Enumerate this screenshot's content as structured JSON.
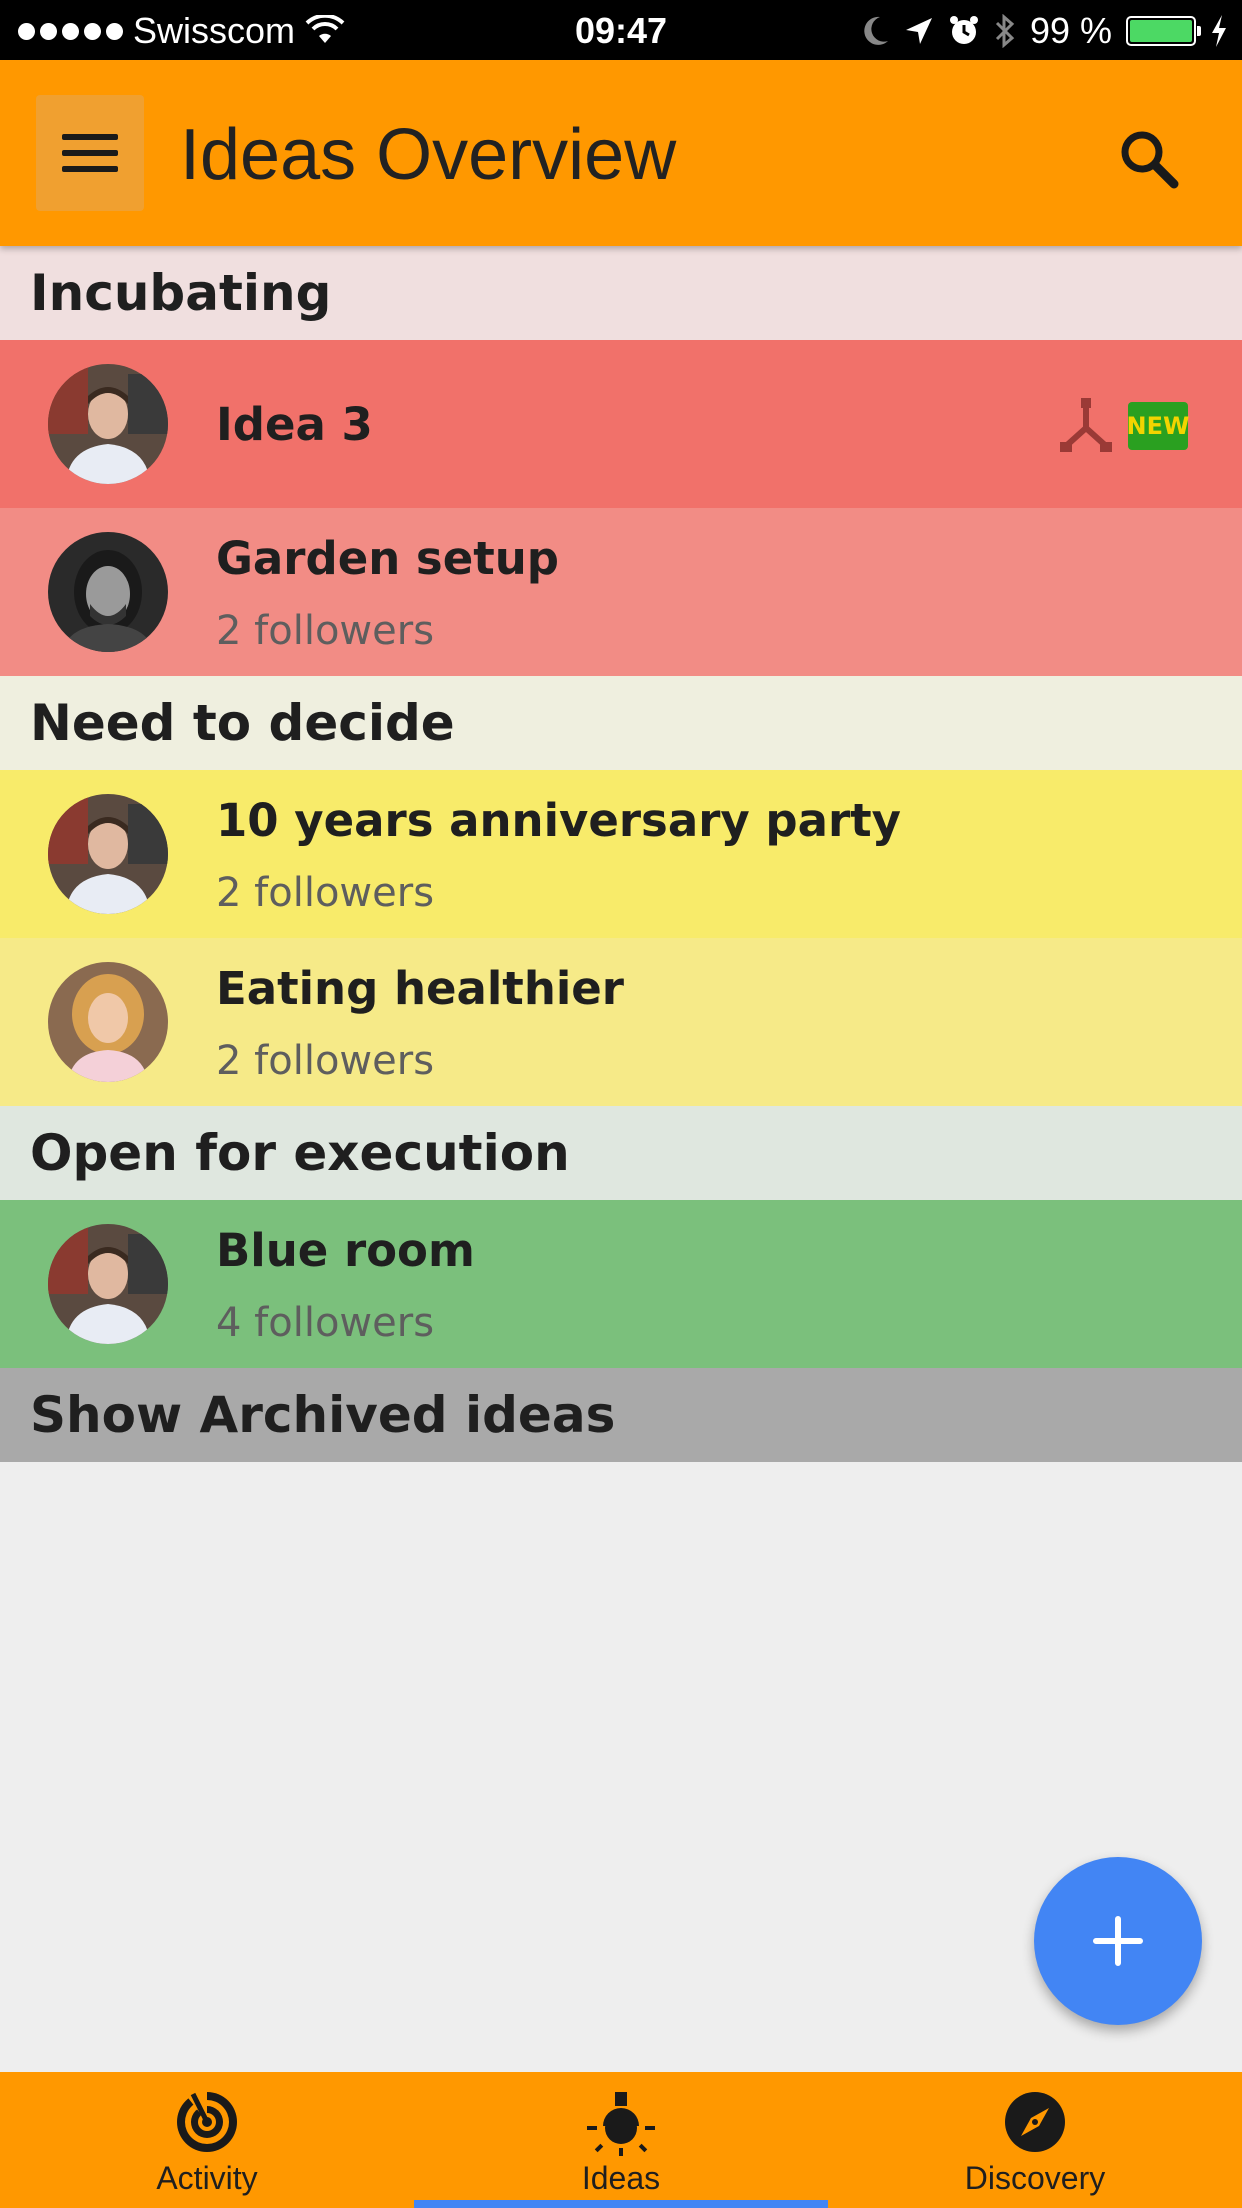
{
  "status_bar": {
    "carrier": "Swisscom",
    "time": "09:47",
    "battery": "99 %"
  },
  "app_bar": {
    "title": "Ideas Overview"
  },
  "sections": {
    "incubating": {
      "label": "Incubating",
      "items": [
        {
          "title": "Idea 3",
          "badge": "NEW"
        },
        {
          "title": "Garden setup",
          "followers": "2 followers"
        }
      ]
    },
    "need_to_decide": {
      "label": "Need to decide",
      "items": [
        {
          "title": "10 years anniversary party",
          "followers": "2 followers"
        },
        {
          "title": "Eating healthier",
          "followers": "2 followers"
        }
      ]
    },
    "open_for_execution": {
      "label": "Open for execution",
      "items": [
        {
          "title": "Blue room",
          "followers": "4 followers"
        }
      ]
    },
    "archived": {
      "label": "Show Archived ideas"
    }
  },
  "colors": {
    "primary": "#ff9800",
    "accent": "#4285f4",
    "incubating_header": "#f0dfdf",
    "incubating_item_new": "#f1716a",
    "incubating_item": "#f28c85",
    "decide_header": "#efefdf",
    "decide_item_1": "#f8eb6a",
    "decide_item_2": "#f6ea88",
    "execution_header": "#dfe7df",
    "execution_item": "#7bc07c",
    "archived_header": "#a9a9a9"
  },
  "bottom_nav": {
    "items": [
      {
        "label": "Activity",
        "icon": "activity-radar-icon"
      },
      {
        "label": "Ideas",
        "icon": "lightbulb-icon",
        "selected": true
      },
      {
        "label": "Discovery",
        "icon": "compass-icon"
      }
    ]
  }
}
